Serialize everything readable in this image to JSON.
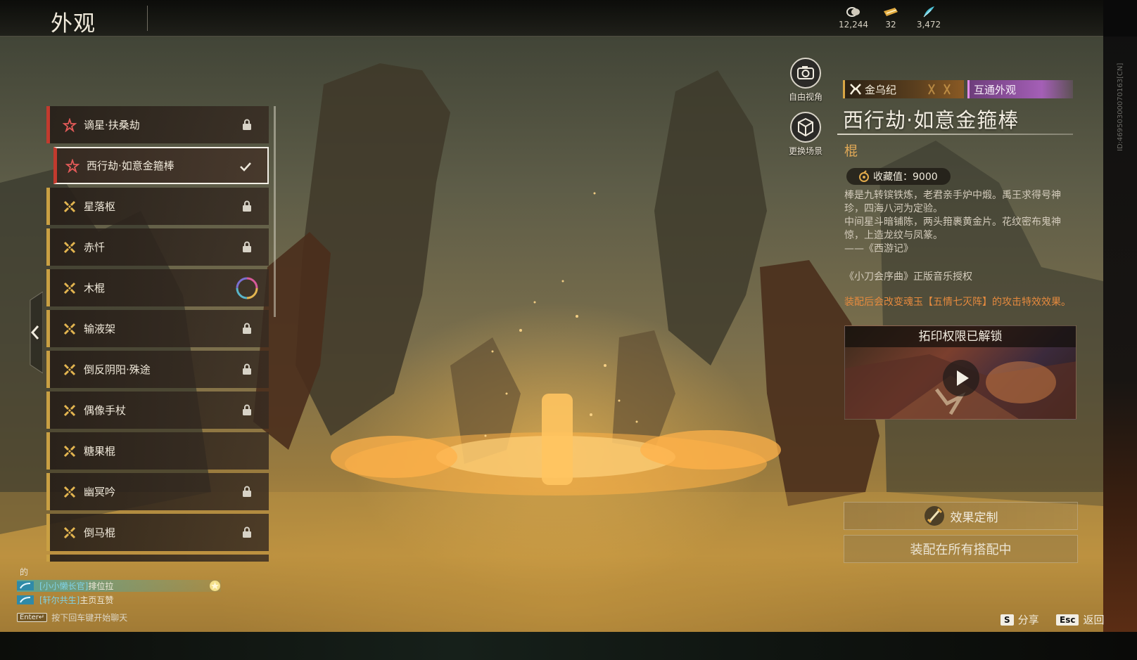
{
  "header": {
    "title": "外观",
    "currencies": [
      {
        "icon": "coin-icon",
        "value": "12,244"
      },
      {
        "icon": "ticket-icon",
        "value": "32"
      },
      {
        "icon": "feather-icon",
        "value": "3,472"
      }
    ]
  },
  "list": {
    "items": [
      {
        "label": "谪星·扶桑劫",
        "rarity": "red",
        "state": "locked"
      },
      {
        "label": "西行劫·如意金箍棒",
        "rarity": "red",
        "state": "equipped"
      },
      {
        "label": "星落枢",
        "rarity": "gold",
        "state": "locked"
      },
      {
        "label": "赤忏",
        "rarity": "gold",
        "state": "locked"
      },
      {
        "label": "木棍",
        "rarity": "gold",
        "state": "ring"
      },
      {
        "label": "输液架",
        "rarity": "gold",
        "state": "locked"
      },
      {
        "label": "倒反阴阳·殊途",
        "rarity": "gold",
        "state": "locked"
      },
      {
        "label": "偶像手杖",
        "rarity": "gold",
        "state": "locked"
      },
      {
        "label": "糖果棍",
        "rarity": "gold",
        "state": "none"
      },
      {
        "label": "幽冥吟",
        "rarity": "gold",
        "state": "locked"
      },
      {
        "label": "倒马棍",
        "rarity": "gold",
        "state": "locked"
      }
    ]
  },
  "camera": {
    "free_view": "自由视角",
    "change_scene": "更换场景"
  },
  "detail": {
    "series_tag": "金乌纪",
    "shared_tag": "互通外观",
    "title": "西行劫·如意金箍棒",
    "type": "棍",
    "collection": "收藏值：9000",
    "description": [
      "棒是九转镔铁炼，老君亲手炉中煅。禹王求得号神珍，四海八河为定验。",
      "中间星斗暗铺陈，两头箝裹黄金片。花纹密布鬼神惊，上造龙纹与凤篆。",
      "——《西游记》"
    ],
    "music_license": "《小刀会序曲》正版音乐授权",
    "effect_note": "装配后会改变魂玉【五情七灭阵】的攻击特效效果。",
    "unlock_title": "拓印权限已解锁",
    "custom_button": "效果定制",
    "equip_all_button": "装配在所有搭配中"
  },
  "chat": {
    "header": "的",
    "lines": [
      {
        "nick": "[小小懒长官]",
        "msg": "排位拉"
      },
      {
        "nick": "[轩尔共生]",
        "msg": "主页互赞"
      }
    ],
    "hint_key": "Enter↵",
    "hint": "按下回车键开始聊天"
  },
  "hotkeys": [
    {
      "key": "S",
      "label": "分享"
    },
    {
      "key": "Esc",
      "label": "返回"
    }
  ],
  "build_id": "ID:46950300070163[CN]",
  "colors": {
    "accent_gold": "#c9a043",
    "accent_red": "#c23a2e",
    "effect_orange": "#e58a3e",
    "shared_purple": "#a45fb6"
  }
}
